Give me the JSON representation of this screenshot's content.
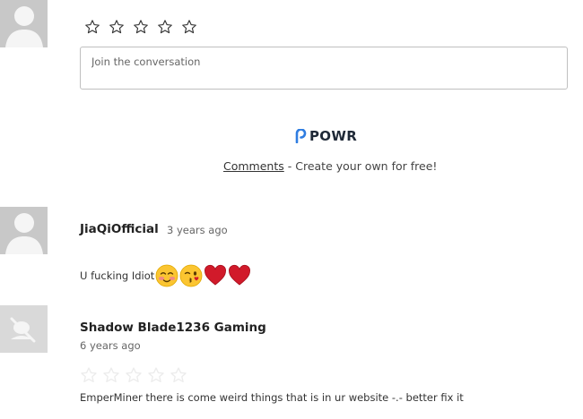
{
  "composer": {
    "placeholder": "Join the conversation",
    "rating": 0,
    "max_rating": 5
  },
  "branding": {
    "logo_text": "POWR",
    "link_label": "Comments",
    "tagline": " - Create your own for free!",
    "accent": "#2f7de1"
  },
  "comments": [
    {
      "author": "JiaQiOfficial",
      "time": "3 years ago",
      "text": "U fucking Idiot",
      "emojis": [
        "blushing-face",
        "kissing-face-wink",
        "red-heart",
        "red-heart"
      ]
    },
    {
      "author": "Shadow Blade1236 Gaming",
      "time": "6 years ago",
      "rating": 0,
      "max_rating": 5,
      "text": "EmperMiner there is come weird things that is in ur website -.- better fix it"
    }
  ],
  "colors": {
    "avatar_bg": "#c8c8c8",
    "heart": "#d11a2a",
    "emoji_face": "#fbc531"
  }
}
